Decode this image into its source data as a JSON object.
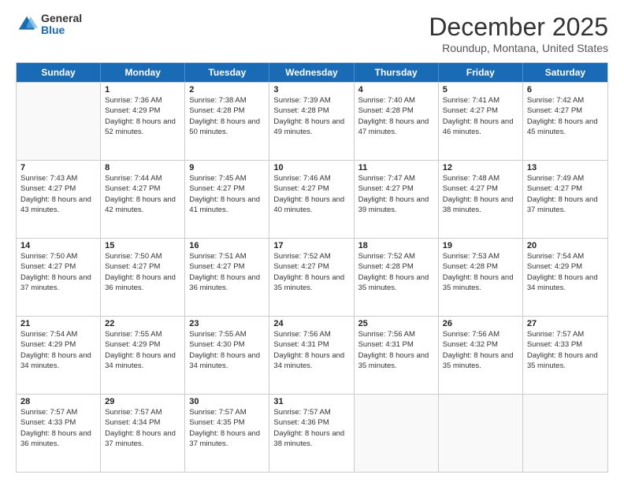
{
  "logo": {
    "general": "General",
    "blue": "Blue"
  },
  "header": {
    "month": "December 2025",
    "location": "Roundup, Montana, United States"
  },
  "days_of_week": [
    "Sunday",
    "Monday",
    "Tuesday",
    "Wednesday",
    "Thursday",
    "Friday",
    "Saturday"
  ],
  "weeks": [
    [
      {
        "day": "",
        "empty": true
      },
      {
        "day": "1",
        "sunrise": "7:36 AM",
        "sunset": "4:29 PM",
        "daylight": "8 hours and 52 minutes."
      },
      {
        "day": "2",
        "sunrise": "7:38 AM",
        "sunset": "4:28 PM",
        "daylight": "8 hours and 50 minutes."
      },
      {
        "day": "3",
        "sunrise": "7:39 AM",
        "sunset": "4:28 PM",
        "daylight": "8 hours and 49 minutes."
      },
      {
        "day": "4",
        "sunrise": "7:40 AM",
        "sunset": "4:28 PM",
        "daylight": "8 hours and 47 minutes."
      },
      {
        "day": "5",
        "sunrise": "7:41 AM",
        "sunset": "4:27 PM",
        "daylight": "8 hours and 46 minutes."
      },
      {
        "day": "6",
        "sunrise": "7:42 AM",
        "sunset": "4:27 PM",
        "daylight": "8 hours and 45 minutes."
      }
    ],
    [
      {
        "day": "7",
        "sunrise": "7:43 AM",
        "sunset": "4:27 PM",
        "daylight": "8 hours and 43 minutes."
      },
      {
        "day": "8",
        "sunrise": "7:44 AM",
        "sunset": "4:27 PM",
        "daylight": "8 hours and 42 minutes."
      },
      {
        "day": "9",
        "sunrise": "7:45 AM",
        "sunset": "4:27 PM",
        "daylight": "8 hours and 41 minutes."
      },
      {
        "day": "10",
        "sunrise": "7:46 AM",
        "sunset": "4:27 PM",
        "daylight": "8 hours and 40 minutes."
      },
      {
        "day": "11",
        "sunrise": "7:47 AM",
        "sunset": "4:27 PM",
        "daylight": "8 hours and 39 minutes."
      },
      {
        "day": "12",
        "sunrise": "7:48 AM",
        "sunset": "4:27 PM",
        "daylight": "8 hours and 38 minutes."
      },
      {
        "day": "13",
        "sunrise": "7:49 AM",
        "sunset": "4:27 PM",
        "daylight": "8 hours and 37 minutes."
      }
    ],
    [
      {
        "day": "14",
        "sunrise": "7:50 AM",
        "sunset": "4:27 PM",
        "daylight": "8 hours and 37 minutes."
      },
      {
        "day": "15",
        "sunrise": "7:50 AM",
        "sunset": "4:27 PM",
        "daylight": "8 hours and 36 minutes."
      },
      {
        "day": "16",
        "sunrise": "7:51 AM",
        "sunset": "4:27 PM",
        "daylight": "8 hours and 36 minutes."
      },
      {
        "day": "17",
        "sunrise": "7:52 AM",
        "sunset": "4:27 PM",
        "daylight": "8 hours and 35 minutes."
      },
      {
        "day": "18",
        "sunrise": "7:52 AM",
        "sunset": "4:28 PM",
        "daylight": "8 hours and 35 minutes."
      },
      {
        "day": "19",
        "sunrise": "7:53 AM",
        "sunset": "4:28 PM",
        "daylight": "8 hours and 35 minutes."
      },
      {
        "day": "20",
        "sunrise": "7:54 AM",
        "sunset": "4:29 PM",
        "daylight": "8 hours and 34 minutes."
      }
    ],
    [
      {
        "day": "21",
        "sunrise": "7:54 AM",
        "sunset": "4:29 PM",
        "daylight": "8 hours and 34 minutes."
      },
      {
        "day": "22",
        "sunrise": "7:55 AM",
        "sunset": "4:29 PM",
        "daylight": "8 hours and 34 minutes."
      },
      {
        "day": "23",
        "sunrise": "7:55 AM",
        "sunset": "4:30 PM",
        "daylight": "8 hours and 34 minutes."
      },
      {
        "day": "24",
        "sunrise": "7:56 AM",
        "sunset": "4:31 PM",
        "daylight": "8 hours and 34 minutes."
      },
      {
        "day": "25",
        "sunrise": "7:56 AM",
        "sunset": "4:31 PM",
        "daylight": "8 hours and 35 minutes."
      },
      {
        "day": "26",
        "sunrise": "7:56 AM",
        "sunset": "4:32 PM",
        "daylight": "8 hours and 35 minutes."
      },
      {
        "day": "27",
        "sunrise": "7:57 AM",
        "sunset": "4:33 PM",
        "daylight": "8 hours and 35 minutes."
      }
    ],
    [
      {
        "day": "28",
        "sunrise": "7:57 AM",
        "sunset": "4:33 PM",
        "daylight": "8 hours and 36 minutes."
      },
      {
        "day": "29",
        "sunrise": "7:57 AM",
        "sunset": "4:34 PM",
        "daylight": "8 hours and 37 minutes."
      },
      {
        "day": "30",
        "sunrise": "7:57 AM",
        "sunset": "4:35 PM",
        "daylight": "8 hours and 37 minutes."
      },
      {
        "day": "31",
        "sunrise": "7:57 AM",
        "sunset": "4:36 PM",
        "daylight": "8 hours and 38 minutes."
      },
      {
        "day": "",
        "empty": true
      },
      {
        "day": "",
        "empty": true
      },
      {
        "day": "",
        "empty": true
      }
    ]
  ]
}
